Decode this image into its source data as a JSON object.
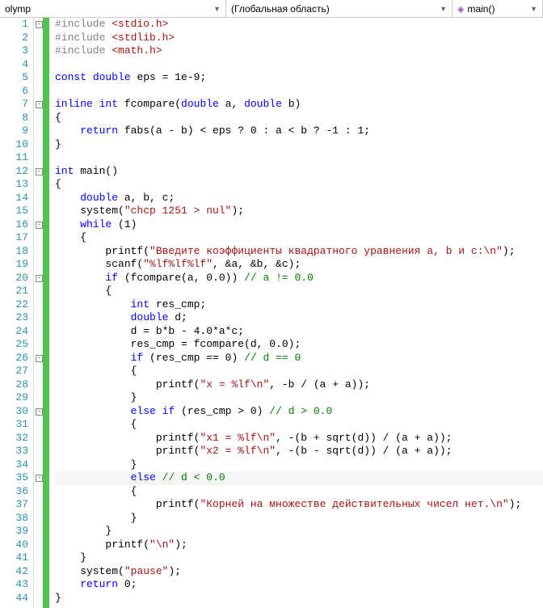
{
  "toolbar": {
    "project": "olymp",
    "scope": "(Глобальная область)",
    "func": "main()"
  },
  "lines": [
    {
      "n": 1,
      "fold": true,
      "seg": [
        [
          "inc",
          "#include "
        ],
        [
          "str",
          "<stdio.h>"
        ]
      ]
    },
    {
      "n": 2,
      "seg": [
        [
          "inc",
          "#include "
        ],
        [
          "str",
          "<stdlib.h>"
        ]
      ]
    },
    {
      "n": 3,
      "seg": [
        [
          "inc",
          "#include "
        ],
        [
          "str",
          "<math.h>"
        ]
      ]
    },
    {
      "n": 4,
      "seg": [
        [
          "txt",
          ""
        ]
      ]
    },
    {
      "n": 5,
      "seg": [
        [
          "kw",
          "const"
        ],
        [
          "txt",
          " "
        ],
        [
          "kw",
          "double"
        ],
        [
          "txt",
          " eps = 1e-9;"
        ]
      ]
    },
    {
      "n": 6,
      "seg": [
        [
          "txt",
          ""
        ]
      ]
    },
    {
      "n": 7,
      "fold": true,
      "seg": [
        [
          "kw",
          "inline"
        ],
        [
          "txt",
          " "
        ],
        [
          "kw",
          "int"
        ],
        [
          "txt",
          " fcompare("
        ],
        [
          "kw",
          "double"
        ],
        [
          "txt",
          " a, "
        ],
        [
          "kw",
          "double"
        ],
        [
          "txt",
          " b)"
        ]
      ]
    },
    {
      "n": 8,
      "seg": [
        [
          "txt",
          "{"
        ]
      ]
    },
    {
      "n": 9,
      "seg": [
        [
          "txt",
          "    "
        ],
        [
          "kw",
          "return"
        ],
        [
          "txt",
          " fabs(a - b) < eps ? 0 : a < b ? -1 : 1;"
        ]
      ]
    },
    {
      "n": 10,
      "seg": [
        [
          "txt",
          "}"
        ]
      ]
    },
    {
      "n": 11,
      "seg": [
        [
          "txt",
          ""
        ]
      ]
    },
    {
      "n": 12,
      "fold": true,
      "seg": [
        [
          "kw",
          "int"
        ],
        [
          "txt",
          " main()"
        ]
      ]
    },
    {
      "n": 13,
      "seg": [
        [
          "txt",
          "{"
        ]
      ]
    },
    {
      "n": 14,
      "seg": [
        [
          "txt",
          "    "
        ],
        [
          "kw",
          "double"
        ],
        [
          "txt",
          " a, b, c;"
        ]
      ]
    },
    {
      "n": 15,
      "seg": [
        [
          "txt",
          "    system("
        ],
        [
          "str",
          "\"chcp 1251 > nul\""
        ],
        [
          "txt",
          ");"
        ]
      ]
    },
    {
      "n": 16,
      "fold": true,
      "seg": [
        [
          "txt",
          "    "
        ],
        [
          "kw",
          "while"
        ],
        [
          "txt",
          " (1)"
        ]
      ]
    },
    {
      "n": 17,
      "seg": [
        [
          "txt",
          "    {"
        ]
      ]
    },
    {
      "n": 18,
      "seg": [
        [
          "txt",
          "        printf("
        ],
        [
          "str",
          "\"Введите коэффициенты квадратного уравнения a, b и c:\\n\""
        ],
        [
          "txt",
          ");"
        ]
      ]
    },
    {
      "n": 19,
      "seg": [
        [
          "txt",
          "        scanf("
        ],
        [
          "str",
          "\"%lf%lf%lf\""
        ],
        [
          "txt",
          ", &a, &b, &c);"
        ]
      ]
    },
    {
      "n": 20,
      "fold": true,
      "seg": [
        [
          "txt",
          "        "
        ],
        [
          "kw",
          "if"
        ],
        [
          "txt",
          " (fcompare(a, 0.0)) "
        ],
        [
          "com",
          "// a != 0.0"
        ]
      ]
    },
    {
      "n": 21,
      "seg": [
        [
          "txt",
          "        {"
        ]
      ]
    },
    {
      "n": 22,
      "seg": [
        [
          "txt",
          "            "
        ],
        [
          "kw",
          "int"
        ],
        [
          "txt",
          " res_cmp;"
        ]
      ]
    },
    {
      "n": 23,
      "seg": [
        [
          "txt",
          "            "
        ],
        [
          "kw",
          "double"
        ],
        [
          "txt",
          " d;"
        ]
      ]
    },
    {
      "n": 24,
      "seg": [
        [
          "txt",
          "            d = b*b - 4.0*a*c;"
        ]
      ]
    },
    {
      "n": 25,
      "seg": [
        [
          "txt",
          "            res_cmp = fcompare(d, 0.0);"
        ]
      ]
    },
    {
      "n": 26,
      "fold": true,
      "seg": [
        [
          "txt",
          "            "
        ],
        [
          "kw",
          "if"
        ],
        [
          "txt",
          " (res_cmp == 0) "
        ],
        [
          "com",
          "// d == 0"
        ]
      ]
    },
    {
      "n": 27,
      "seg": [
        [
          "txt",
          "            {"
        ]
      ]
    },
    {
      "n": 28,
      "seg": [
        [
          "txt",
          "                printf("
        ],
        [
          "str",
          "\"x = %lf\\n\""
        ],
        [
          "txt",
          ", -b / (a + a));"
        ]
      ]
    },
    {
      "n": 29,
      "seg": [
        [
          "txt",
          "            }"
        ]
      ]
    },
    {
      "n": 30,
      "fold": true,
      "seg": [
        [
          "txt",
          "            "
        ],
        [
          "kw",
          "else"
        ],
        [
          "txt",
          " "
        ],
        [
          "kw",
          "if"
        ],
        [
          "txt",
          " (res_cmp > 0) "
        ],
        [
          "com",
          "// d > 0.0"
        ]
      ]
    },
    {
      "n": 31,
      "seg": [
        [
          "txt",
          "            {"
        ]
      ]
    },
    {
      "n": 32,
      "seg": [
        [
          "txt",
          "                printf("
        ],
        [
          "str",
          "\"x1 = %lf\\n\""
        ],
        [
          "txt",
          ", -(b + sqrt(d)) / (a + a));"
        ]
      ]
    },
    {
      "n": 33,
      "seg": [
        [
          "txt",
          "                printf("
        ],
        [
          "str",
          "\"x2 = %lf\\n\""
        ],
        [
          "txt",
          ", -(b - sqrt(d)) / (a + a));"
        ]
      ]
    },
    {
      "n": 34,
      "seg": [
        [
          "txt",
          "            }"
        ]
      ]
    },
    {
      "n": 35,
      "fold": true,
      "current": true,
      "seg": [
        [
          "txt",
          "            "
        ],
        [
          "kw",
          "else"
        ],
        [
          "txt",
          " "
        ],
        [
          "com",
          "// d < 0.0"
        ]
      ]
    },
    {
      "n": 36,
      "seg": [
        [
          "txt",
          "            {"
        ]
      ]
    },
    {
      "n": 37,
      "seg": [
        [
          "txt",
          "                printf("
        ],
        [
          "str",
          "\"Корней на множестве действительных чисел нет.\\n\""
        ],
        [
          "txt",
          ");"
        ]
      ]
    },
    {
      "n": 38,
      "seg": [
        [
          "txt",
          "            }"
        ]
      ]
    },
    {
      "n": 39,
      "seg": [
        [
          "txt",
          "        }"
        ]
      ]
    },
    {
      "n": 40,
      "seg": [
        [
          "txt",
          "        printf("
        ],
        [
          "str",
          "\"\\n\""
        ],
        [
          "txt",
          ");"
        ]
      ]
    },
    {
      "n": 41,
      "seg": [
        [
          "txt",
          "    }"
        ]
      ]
    },
    {
      "n": 42,
      "seg": [
        [
          "txt",
          "    system("
        ],
        [
          "str",
          "\"pause\""
        ],
        [
          "txt",
          ");"
        ]
      ]
    },
    {
      "n": 43,
      "seg": [
        [
          "txt",
          "    "
        ],
        [
          "kw",
          "return"
        ],
        [
          "txt",
          " 0;"
        ]
      ]
    },
    {
      "n": 44,
      "seg": [
        [
          "txt",
          "}"
        ]
      ]
    }
  ]
}
